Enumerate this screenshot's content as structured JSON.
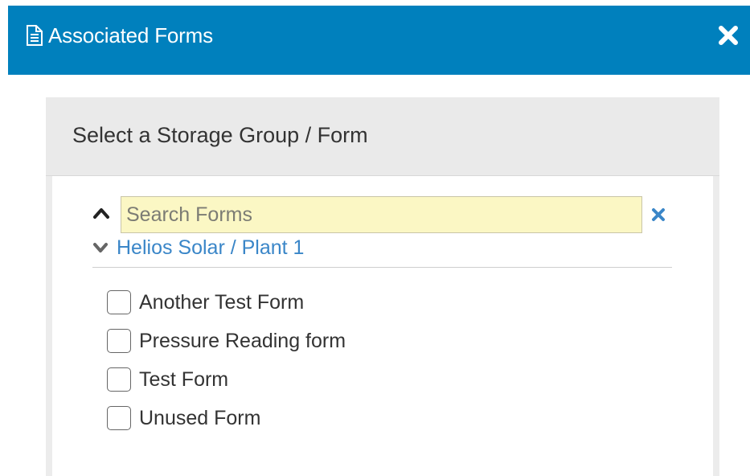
{
  "modal": {
    "title": "Associated Forms",
    "header_color": "#0080bd",
    "icons": {
      "title": "document-icon",
      "close": "close-icon"
    }
  },
  "panel": {
    "heading": "Select a Storage Group / Form"
  },
  "search": {
    "placeholder": "Search Forms",
    "value": "",
    "icons": {
      "collapse": "chevron-up-icon",
      "clear": "clear-icon"
    }
  },
  "storage_group": {
    "label": "Helios Solar / Plant 1",
    "icon": "chevron-down-icon",
    "link_color": "#3a86c8"
  },
  "forms": [
    {
      "label": "Another Test Form",
      "checked": false
    },
    {
      "label": "Pressure Reading form",
      "checked": false
    },
    {
      "label": "Test Form",
      "checked": false
    },
    {
      "label": "Unused Form",
      "checked": false
    }
  ]
}
